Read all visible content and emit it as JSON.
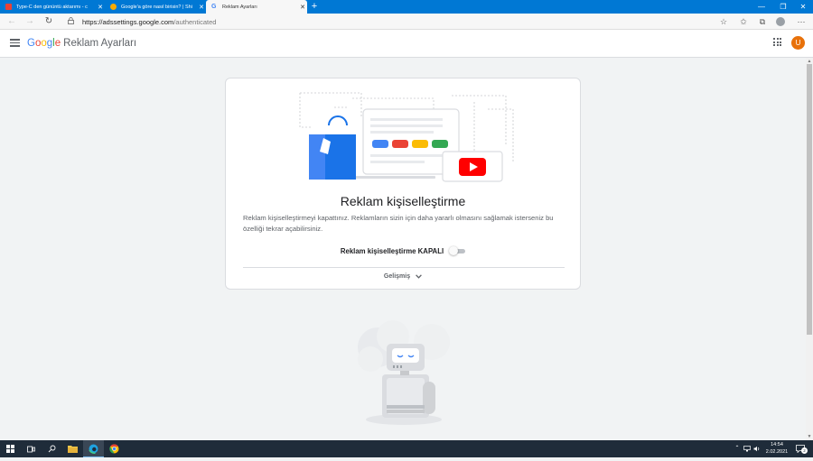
{
  "browser": {
    "tabs": [
      {
        "title": "Type-C den gününtü aktarımı - c",
        "favicon_color": "#e94235",
        "active": false
      },
      {
        "title": "Google'a göre nasıl birisin? | Shi",
        "favicon_color": "#f9ab00",
        "active": false
      },
      {
        "title": "Reklam Ayarları",
        "favicon_color": "#4285f4",
        "active": true
      }
    ],
    "tab_close": "✕",
    "new_tab": "+",
    "window_controls": {
      "minimize": "—",
      "restore": "❐",
      "close": "✕"
    },
    "address": {
      "host": "https://adssettings.google.com",
      "path": "/authenticated"
    },
    "nav_icons": {
      "back": "←",
      "forward": "→",
      "refresh": "↻"
    },
    "toolbar_icons": {
      "favorite_add": "☆",
      "favorites": "✩",
      "collections": "⧉",
      "more": "⋯"
    }
  },
  "app": {
    "logo_letters": [
      {
        "ch": "G",
        "color": "#4285f4"
      },
      {
        "ch": "o",
        "color": "#ea4335"
      },
      {
        "ch": "o",
        "color": "#fbbc05"
      },
      {
        "ch": "g",
        "color": "#4285f4"
      },
      {
        "ch": "l",
        "color": "#34a853"
      },
      {
        "ch": "e",
        "color": "#ea4335"
      }
    ],
    "product_name": "Reklam Ayarları",
    "avatar_letter": "U",
    "avatar_color": "#e8710a"
  },
  "card": {
    "title": "Reklam kişiselleştirme",
    "description": "Reklam kişiselleştirmeyi kapattınız. Reklamların sizin için daha yararlı olmasını sağlamak isterseniz bu özelliği tekrar açabilirsiniz.",
    "toggle_label": "Reklam kişiselleştirme KAPALI",
    "toggle_on": false,
    "advanced_label": "Gelişmiş"
  },
  "taskbar": {
    "time": "14:54",
    "date": "2.02.2021",
    "tray_up": "⌃",
    "notification_count": "2"
  },
  "colors": {
    "blue": "#4285f4",
    "red": "#ea4335",
    "yellow": "#fbbc05",
    "green": "#34a853",
    "youtube": "#ff0000",
    "edge_blue": "#0078d4"
  }
}
